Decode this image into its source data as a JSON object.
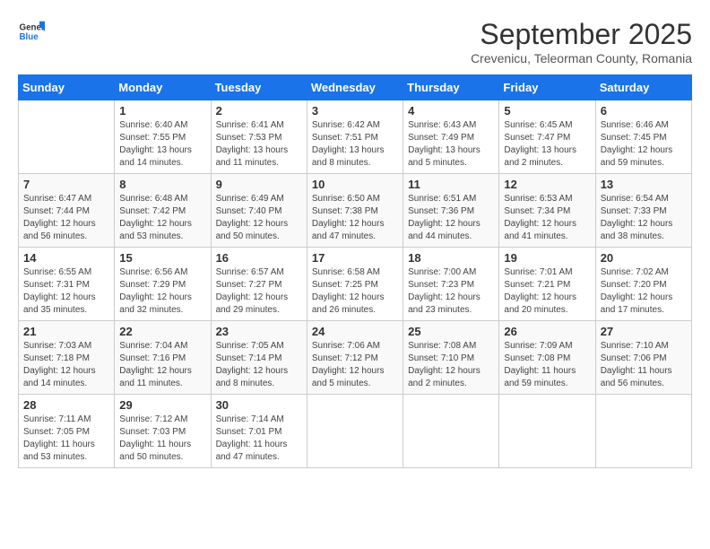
{
  "header": {
    "logo_line1": "General",
    "logo_line2": "Blue",
    "month_title": "September 2025",
    "subtitle": "Crevenicu, Teleorman County, Romania"
  },
  "days_of_week": [
    "Sunday",
    "Monday",
    "Tuesday",
    "Wednesday",
    "Thursday",
    "Friday",
    "Saturday"
  ],
  "weeks": [
    [
      {
        "day": "",
        "info": ""
      },
      {
        "day": "1",
        "info": "Sunrise: 6:40 AM\nSunset: 7:55 PM\nDaylight: 13 hours\nand 14 minutes."
      },
      {
        "day": "2",
        "info": "Sunrise: 6:41 AM\nSunset: 7:53 PM\nDaylight: 13 hours\nand 11 minutes."
      },
      {
        "day": "3",
        "info": "Sunrise: 6:42 AM\nSunset: 7:51 PM\nDaylight: 13 hours\nand 8 minutes."
      },
      {
        "day": "4",
        "info": "Sunrise: 6:43 AM\nSunset: 7:49 PM\nDaylight: 13 hours\nand 5 minutes."
      },
      {
        "day": "5",
        "info": "Sunrise: 6:45 AM\nSunset: 7:47 PM\nDaylight: 13 hours\nand 2 minutes."
      },
      {
        "day": "6",
        "info": "Sunrise: 6:46 AM\nSunset: 7:45 PM\nDaylight: 12 hours\nand 59 minutes."
      }
    ],
    [
      {
        "day": "7",
        "info": "Sunrise: 6:47 AM\nSunset: 7:44 PM\nDaylight: 12 hours\nand 56 minutes."
      },
      {
        "day": "8",
        "info": "Sunrise: 6:48 AM\nSunset: 7:42 PM\nDaylight: 12 hours\nand 53 minutes."
      },
      {
        "day": "9",
        "info": "Sunrise: 6:49 AM\nSunset: 7:40 PM\nDaylight: 12 hours\nand 50 minutes."
      },
      {
        "day": "10",
        "info": "Sunrise: 6:50 AM\nSunset: 7:38 PM\nDaylight: 12 hours\nand 47 minutes."
      },
      {
        "day": "11",
        "info": "Sunrise: 6:51 AM\nSunset: 7:36 PM\nDaylight: 12 hours\nand 44 minutes."
      },
      {
        "day": "12",
        "info": "Sunrise: 6:53 AM\nSunset: 7:34 PM\nDaylight: 12 hours\nand 41 minutes."
      },
      {
        "day": "13",
        "info": "Sunrise: 6:54 AM\nSunset: 7:33 PM\nDaylight: 12 hours\nand 38 minutes."
      }
    ],
    [
      {
        "day": "14",
        "info": "Sunrise: 6:55 AM\nSunset: 7:31 PM\nDaylight: 12 hours\nand 35 minutes."
      },
      {
        "day": "15",
        "info": "Sunrise: 6:56 AM\nSunset: 7:29 PM\nDaylight: 12 hours\nand 32 minutes."
      },
      {
        "day": "16",
        "info": "Sunrise: 6:57 AM\nSunset: 7:27 PM\nDaylight: 12 hours\nand 29 minutes."
      },
      {
        "day": "17",
        "info": "Sunrise: 6:58 AM\nSunset: 7:25 PM\nDaylight: 12 hours\nand 26 minutes."
      },
      {
        "day": "18",
        "info": "Sunrise: 7:00 AM\nSunset: 7:23 PM\nDaylight: 12 hours\nand 23 minutes."
      },
      {
        "day": "19",
        "info": "Sunrise: 7:01 AM\nSunset: 7:21 PM\nDaylight: 12 hours\nand 20 minutes."
      },
      {
        "day": "20",
        "info": "Sunrise: 7:02 AM\nSunset: 7:20 PM\nDaylight: 12 hours\nand 17 minutes."
      }
    ],
    [
      {
        "day": "21",
        "info": "Sunrise: 7:03 AM\nSunset: 7:18 PM\nDaylight: 12 hours\nand 14 minutes."
      },
      {
        "day": "22",
        "info": "Sunrise: 7:04 AM\nSunset: 7:16 PM\nDaylight: 12 hours\nand 11 minutes."
      },
      {
        "day": "23",
        "info": "Sunrise: 7:05 AM\nSunset: 7:14 PM\nDaylight: 12 hours\nand 8 minutes."
      },
      {
        "day": "24",
        "info": "Sunrise: 7:06 AM\nSunset: 7:12 PM\nDaylight: 12 hours\nand 5 minutes."
      },
      {
        "day": "25",
        "info": "Sunrise: 7:08 AM\nSunset: 7:10 PM\nDaylight: 12 hours\nand 2 minutes."
      },
      {
        "day": "26",
        "info": "Sunrise: 7:09 AM\nSunset: 7:08 PM\nDaylight: 11 hours\nand 59 minutes."
      },
      {
        "day": "27",
        "info": "Sunrise: 7:10 AM\nSunset: 7:06 PM\nDaylight: 11 hours\nand 56 minutes."
      }
    ],
    [
      {
        "day": "28",
        "info": "Sunrise: 7:11 AM\nSunset: 7:05 PM\nDaylight: 11 hours\nand 53 minutes."
      },
      {
        "day": "29",
        "info": "Sunrise: 7:12 AM\nSunset: 7:03 PM\nDaylight: 11 hours\nand 50 minutes."
      },
      {
        "day": "30",
        "info": "Sunrise: 7:14 AM\nSunset: 7:01 PM\nDaylight: 11 hours\nand 47 minutes."
      },
      {
        "day": "",
        "info": ""
      },
      {
        "day": "",
        "info": ""
      },
      {
        "day": "",
        "info": ""
      },
      {
        "day": "",
        "info": ""
      }
    ]
  ]
}
